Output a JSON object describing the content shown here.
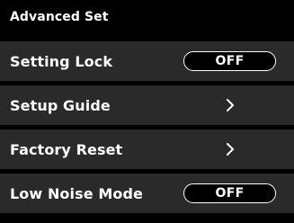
{
  "header": {
    "title": "Advanced Set"
  },
  "menu": {
    "items": [
      {
        "label": "Setting Lock",
        "control": "toggle",
        "value": "OFF"
      },
      {
        "label": "Setup Guide",
        "control": "chevron",
        "icon": "chevron-right-icon"
      },
      {
        "label": "Factory Reset",
        "control": "chevron",
        "icon": "chevron-right-icon"
      },
      {
        "label": "Low Noise Mode",
        "control": "toggle",
        "value": "OFF"
      }
    ]
  },
  "colors": {
    "background": "#000000",
    "row_background": "#2a2a2a",
    "text": "#ffffff"
  }
}
